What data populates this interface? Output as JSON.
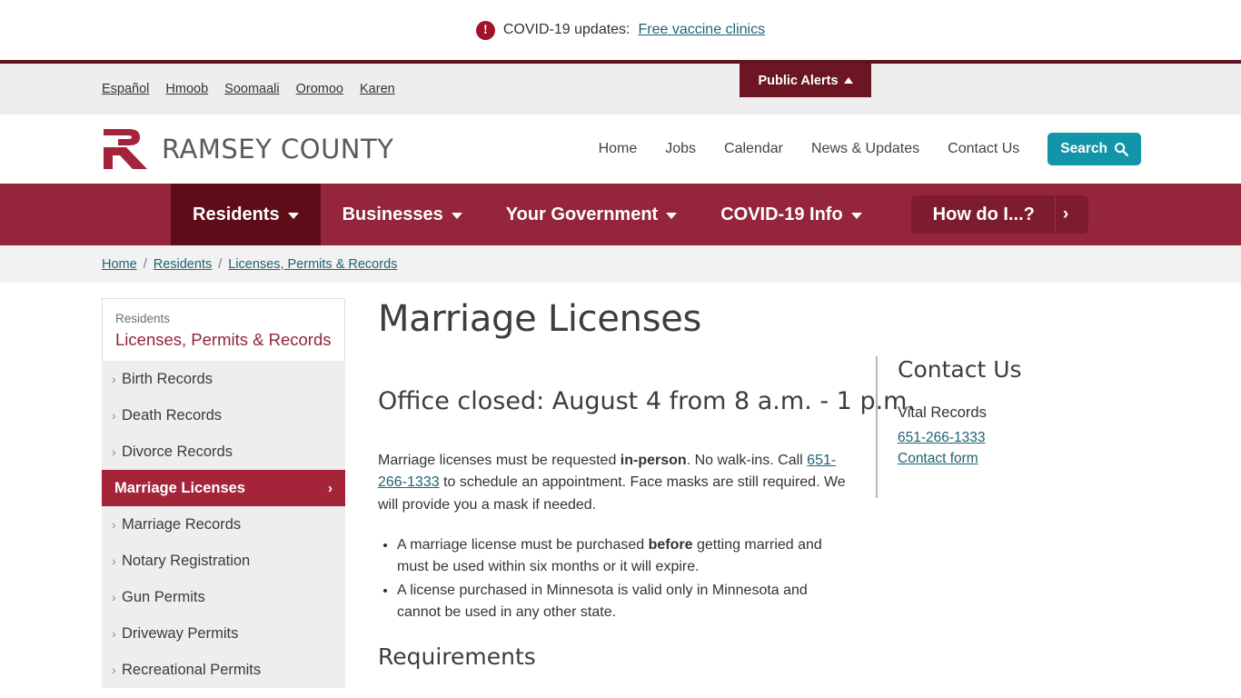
{
  "covid_banner": {
    "icon": "alert-circle-icon",
    "text": "COVID-19 updates:",
    "link_label": "Free vaccine clinics"
  },
  "language_bar": {
    "languages": [
      "Español",
      "Hmoob",
      "Soomaali",
      "Oromoo",
      "Karen"
    ],
    "public_alerts_label": "Public Alerts"
  },
  "header": {
    "logo_text": "RAMSEY COUNTY",
    "utility_nav": [
      "Home",
      "Jobs",
      "Calendar",
      "News & Updates",
      "Contact Us"
    ],
    "search_label": "Search"
  },
  "main_nav": {
    "items": [
      {
        "label": "Residents",
        "active": true
      },
      {
        "label": "Businesses",
        "active": false
      },
      {
        "label": "Your Government",
        "active": false
      },
      {
        "label": "COVID-19 Info",
        "active": false
      }
    ],
    "how_do_i_label": "How do I...?",
    "how_do_i_arrow": "›"
  },
  "breadcrumb": {
    "items": [
      "Home",
      "Residents",
      "Licenses, Permits & Records"
    ],
    "separator": "/"
  },
  "sidebar": {
    "eyebrow": "Residents",
    "title": "Licenses, Permits & Records",
    "items": [
      {
        "label": "Birth Records",
        "active": false
      },
      {
        "label": "Death Records",
        "active": false
      },
      {
        "label": "Divorce Records",
        "active": false
      },
      {
        "label": "Marriage Licenses",
        "active": true
      },
      {
        "label": "Marriage Records",
        "active": false
      },
      {
        "label": "Notary Registration",
        "active": false
      },
      {
        "label": "Gun Permits",
        "active": false
      },
      {
        "label": "Driveway Permits",
        "active": false
      },
      {
        "label": "Recreational Permits",
        "active": false
      }
    ]
  },
  "main": {
    "page_title": "Marriage Licenses",
    "closure_notice": "Office closed: August 4 from 8 a.m. - 1 p.m.",
    "intro": {
      "part1": "Marriage licenses must be requested ",
      "bold1": "in-person",
      "part2": ". No walk-ins. Call ",
      "phone_link": "651-266-1333",
      "part3": " to schedule an appointment. Face masks are still required. We will provide you a mask if needed."
    },
    "bullets": [
      {
        "part1": "A marriage license must be purchased ",
        "bold": "before",
        "part2": " getting married and must be used within six months or it will expire."
      },
      {
        "part1": "A license purchased in Minnesota is valid only in Minnesota and cannot be used in any other state.",
        "bold": "",
        "part2": ""
      }
    ],
    "requirements_heading": "Requirements"
  },
  "right_rail": {
    "title": "Contact Us",
    "department": "Vital Records",
    "phone": "651-266-1333",
    "contact_form_label": "Contact form"
  },
  "colors": {
    "brand_red": "#94253a",
    "brand_dark_red": "#5e0d18",
    "accent_teal": "#1295a8",
    "link_teal": "#1d6374",
    "active_item_red": "#a4243b"
  }
}
